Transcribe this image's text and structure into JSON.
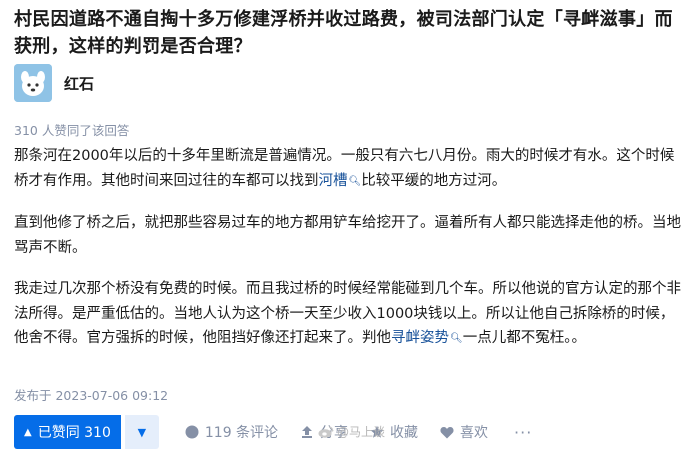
{
  "question": {
    "title": "村民因道路不通自掏十多万修建浮桥并收过路费，被司法部门认定「寻衅滋事」而获刑，这样的判罚是否合理？"
  },
  "author": {
    "name": "红石"
  },
  "answer": {
    "vote_summary": "310 人赞同了该回答",
    "paragraphs": [
      {
        "before": "那条河在2000年以后的十多年里断流是普遍情况。一般只有六七八月份。雨大的时候才有水。这个时候桥才有作用。其他时间来回过往的车都可以找到",
        "keyword": "河槽",
        "after": "比较平缓的地方过河。"
      },
      {
        "before": "直到他修了桥之后，就把那些容易过车的地方都用铲车给挖开了。逼着所有人都只能选择走他的桥。当地骂声不断。",
        "keyword": "",
        "after": ""
      },
      {
        "before": "我走过几次那个桥没有免费的时候。而且我过桥的时候经常能碰到几个车。所以他说的官方认定的那个非法所得。是严重低估的。当地人认为这个桥一天至少收入1000块钱以上。所以让他自己拆除桥的时候，他舍不得。官方强拆的时候，他阻挡好像还打起来了。判他",
        "keyword": "寻衅姿势",
        "after": "一点儿都不冤枉。。"
      }
    ],
    "publish_time": "发布于 2023-07-06 09:12"
  },
  "actions": {
    "agree_label": "已赞同 310",
    "comments_label": "119 条评论",
    "share_label": "分享",
    "favorite_label": "收藏",
    "like_label": "喜欢",
    "more_label": "···"
  },
  "watermark": {
    "text": "@马上谈"
  },
  "icons": {
    "agree": "triangle-up-icon",
    "disagree": "triangle-down-icon",
    "comment": "comment-icon",
    "share": "share-icon",
    "favorite": "star-icon",
    "like": "heart-icon",
    "keyword_search": "search-icon"
  },
  "colors": {
    "accent": "#056de8",
    "link": "#175199",
    "muted": "#8590a6"
  }
}
